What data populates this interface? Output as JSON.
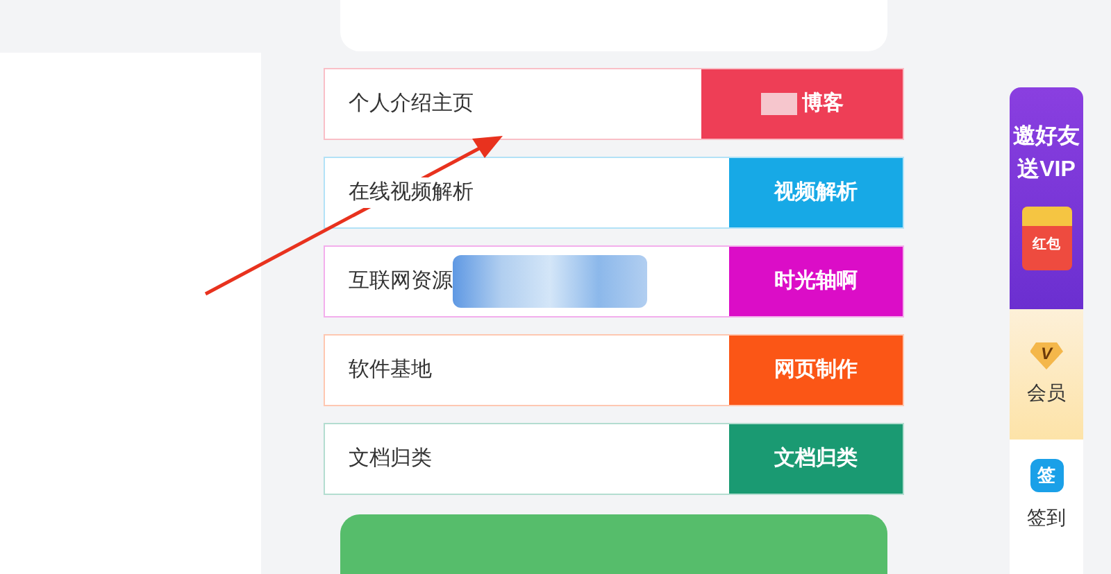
{
  "links": [
    {
      "label": "个人介绍主页",
      "button": "博客",
      "color": "#ee3e56",
      "kind": "button-blur",
      "wide": true
    },
    {
      "label": "在线视频解析",
      "button": "视频解析",
      "color": "#17a9e6",
      "kind": "plain",
      "wide": false
    },
    {
      "label": "互联网资源",
      "button": "时光轴啊",
      "color": "#db0dc7",
      "kind": "label-blur",
      "wide": false
    },
    {
      "label": "软件基地",
      "button": "网页制作",
      "color": "#fb5616",
      "kind": "plain",
      "wide": false
    },
    {
      "label": "文档归类",
      "button": "文档归类",
      "color": "#1a9a72",
      "kind": "plain",
      "wide": false
    }
  ],
  "sidebar": {
    "invite": "邀好友送VIP",
    "envelope": "红包",
    "vip_icon": "V",
    "vip_label": "会员",
    "signin_icon": "签",
    "signin_label": "签到"
  }
}
